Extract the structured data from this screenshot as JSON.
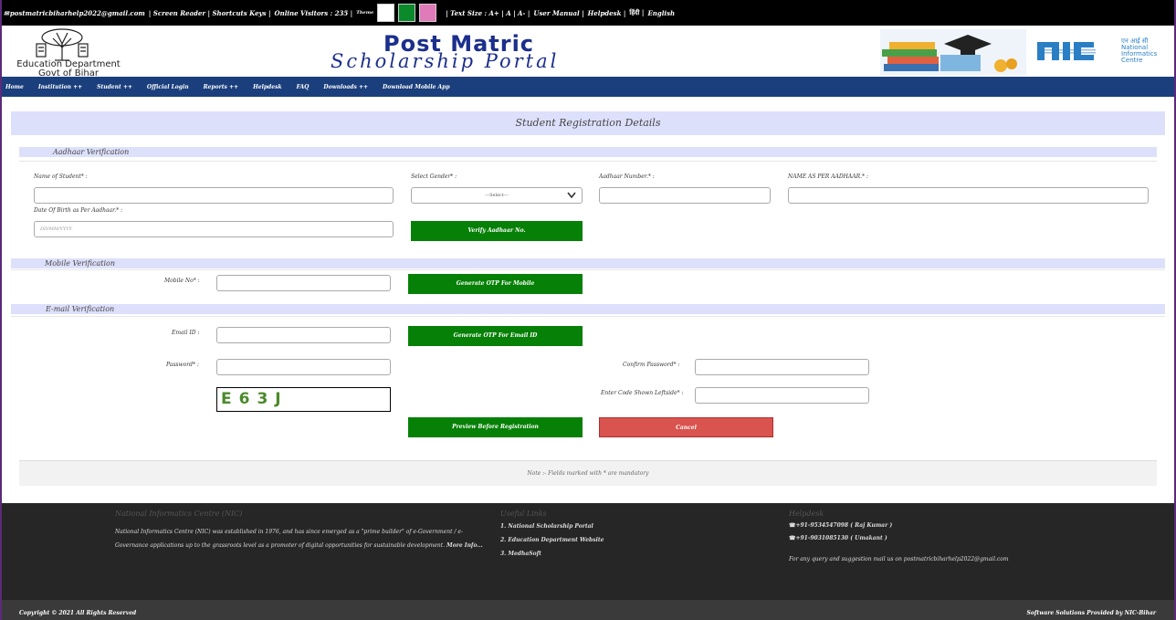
{
  "topbar": {
    "email": "postmatricbiharhelp2022@gmail.com",
    "screen_reader": "| Screen Reader | Shortcuts Keys |",
    "visitors": "Online Visitors : 235 |",
    "theme": "Theme",
    "text_size": "| Text Size : A+ | A | A- |",
    "user_manual": "User Manual |",
    "helpdesk": "Helpdesk |",
    "hindi": "हिंदी |",
    "english": "English",
    "swatch_colors": [
      "#ffffff",
      "#0a8a2a",
      "#e07ab8"
    ]
  },
  "header": {
    "dept_line1": "Education Department",
    "dept_line2": "Govt of Bihar",
    "title_line1": "Post Matric",
    "title_line2": "Scholarship Portal",
    "nic_hindi": "एन आई सी",
    "nic_text": "NIC",
    "nic_sub1": "National",
    "nic_sub2": "Informatics",
    "nic_sub3": "Centre"
  },
  "nav": {
    "items": [
      "Home",
      "Institution ++",
      "Student ++",
      "Official Login",
      "Reports ++",
      "Helpdesk",
      "FAQ",
      "Downloads ++",
      "Download Mobile App"
    ]
  },
  "form": {
    "title": "Student Registration Details",
    "aadhaar_section": "Aadhaar Verification",
    "name_label": "Name of Student* :",
    "gender_label": "Select Gender* :",
    "gender_value": "---Select---",
    "aadhaar_label": "Aadhaar Number.* :",
    "name_aadhaar_label": "NAME AS PER AADHAAR.* :",
    "dob_label": "Date Of Birth as Per Aadhaar.* :",
    "dob_placeholder": "DD/MM/YYYY",
    "verify_button": "Verify Aadhaar No.",
    "mobile_section": "Mobile Verification",
    "mobile_label": "Mobile No* :",
    "otp_mobile_button": "Generate OTP For Mobile",
    "email_section": "E-mail Verification",
    "email_label": "Email ID :",
    "otp_email_button": "Generate OTP For Email ID",
    "password_label": "Password* :",
    "confirm_password_label": "Confirm Password* :",
    "captcha_text": "E63J",
    "code_label": "Enter Code Shown Leftside* :",
    "preview_button": "Preview Before Registration",
    "cancel_button": "Cancel",
    "note": "Note :- Fields marked with * are mandatory"
  },
  "footer": {
    "nic_heading": "National Informatics Centre (NIC)",
    "nic_para": "National Informatics Centre (NIC) was established in 1976, and has since emerged as a \"prime builder\" of e-Government / e-Governance applications up to the grassroots level as a promoter of digital opportunities for sustainable development.",
    "more_info": "More Info...",
    "links_heading": "Useful Links",
    "links": [
      "1. National Scholarship Portal",
      "2. Education Department Website",
      "3. MedhaSoft"
    ],
    "help_heading": "Helpdesk",
    "phone1": "+91-9534547098 ( Raj Kumar )",
    "phone2": "+91-9031085130 ( Umakant )",
    "query": "For any query and suggestion mail us on postmatricbiharhelp2022@gmail.com",
    "copyright": "Copyright © 2021 All Rights Reserved",
    "provided": "Software Solutions Provided by NIC-Bihar"
  }
}
